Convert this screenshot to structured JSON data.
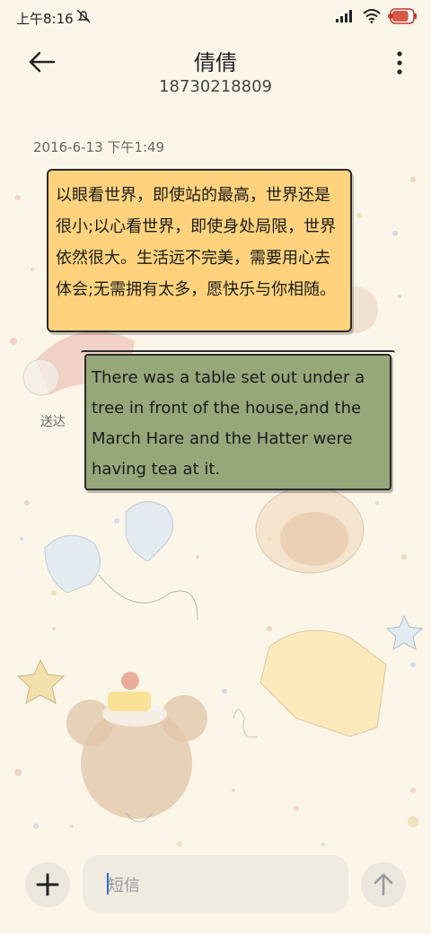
{
  "status_bar": {
    "time": "上午8:16",
    "battery_level": 0.8
  },
  "header": {
    "contact_name": "倩倩",
    "contact_number": "18730218809"
  },
  "conversation": {
    "timestamp": "2016-6-13 下午1:49",
    "messages": [
      {
        "text": "以眼看世界，即使站的最高，世界还是很小;以心看世界，即使身处局限，世界依然很大。生活远不完美，需要用心去体会;无需拥有太多，愿快乐与你相随。"
      },
      {
        "text": "There was a table set out under a tree in front of the house,and the March Hare and the Hatter were having tea at it."
      }
    ],
    "delivery_status": "送达"
  },
  "composer": {
    "placeholder": "短信"
  },
  "colors": {
    "bubble_yellow": "#ffd37d",
    "bubble_green": "#96a87a",
    "background": "#fbf6e8"
  },
  "icons": {
    "back": "arrow-left-icon",
    "more": "more-vertical-icon",
    "add": "plus-icon",
    "send": "arrow-up-icon",
    "signal": "signal-icon",
    "wifi": "wifi-icon",
    "battery": "battery-icon",
    "mute": "bell-off-icon"
  }
}
